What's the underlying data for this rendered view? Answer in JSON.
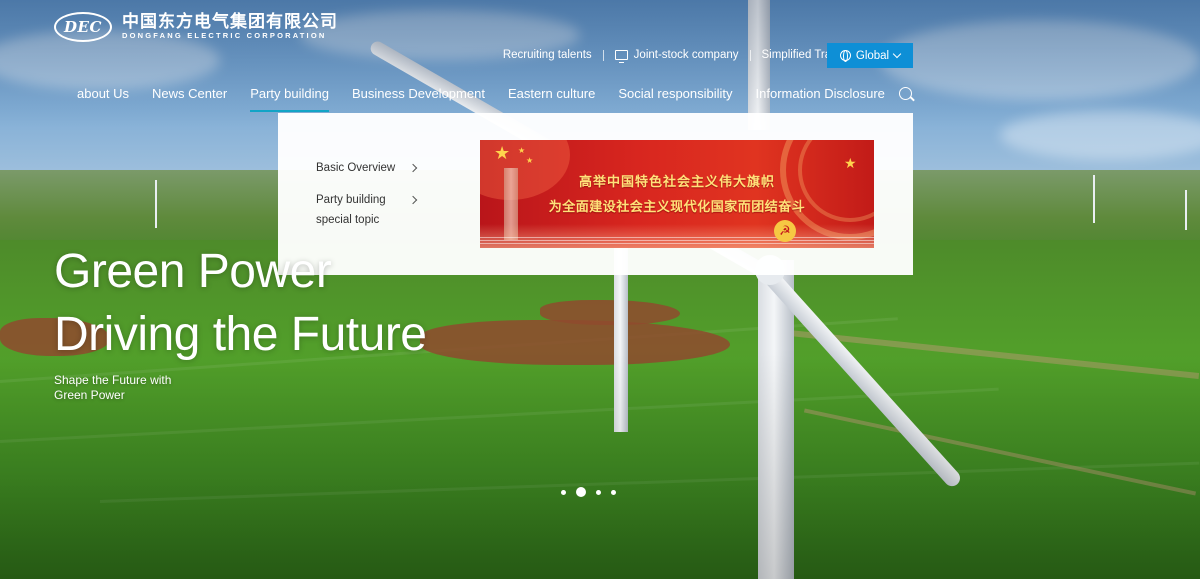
{
  "logo": {
    "mark": "DEC",
    "name_cn": "中国东方电气集团有限公司",
    "name_en": "DONGFANG ELECTRIC CORPORATION"
  },
  "topbar": {
    "recruiting": "Recruiting talents",
    "joint_stock": "Joint-stock company",
    "language": "Simplified Traditional Chinese",
    "global": "Global"
  },
  "nav": {
    "items": [
      {
        "label": "about Us"
      },
      {
        "label": "News Center"
      },
      {
        "label": "Party building",
        "active": true
      },
      {
        "label": "Business Development"
      },
      {
        "label": "Eastern culture"
      },
      {
        "label": "Social responsibility"
      },
      {
        "label": "Information Disclosure"
      }
    ],
    "search_icon": "search-icon"
  },
  "dropdown": {
    "items": [
      {
        "label": "Basic Overview"
      },
      {
        "label_line1": "Party building",
        "label_line2": "special topic"
      }
    ],
    "banner": {
      "line1": "高举中国特色社会主义伟大旗帜",
      "line2": "为全面建设社会主义现代化国家而团结奋斗"
    }
  },
  "hero": {
    "title_line1": "Green Power",
    "title_line2": "Driving the Future",
    "subtitle_line1": "Shape the Future with",
    "subtitle_line2": "Green Power"
  },
  "carousel": {
    "count": 4,
    "active_index": 2
  },
  "colors": {
    "accent": "#0e8fd6",
    "active_underline": "#12a4c6",
    "banner_red": "#d8261f",
    "banner_text": "#ffe27a"
  }
}
